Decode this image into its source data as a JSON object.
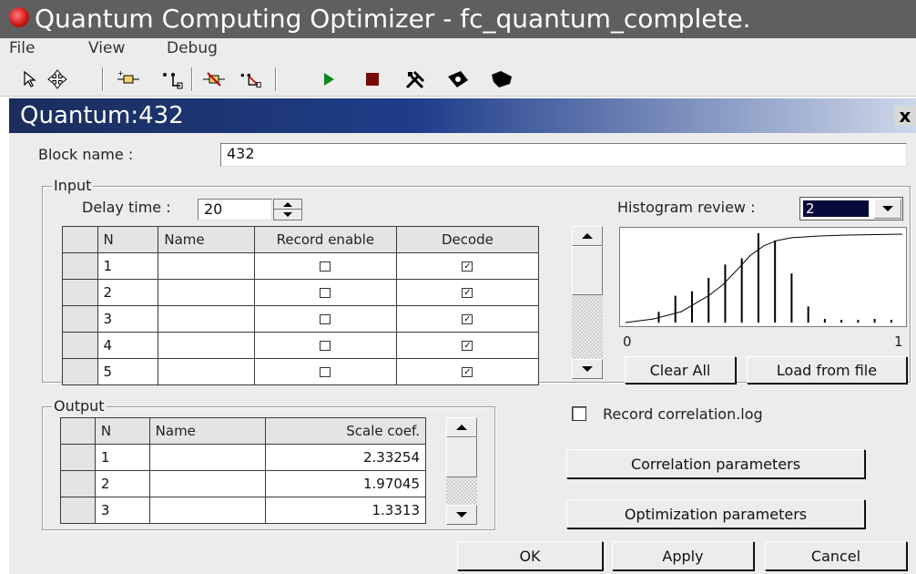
{
  "app": {
    "title": "Quantum Computing Optimizer - fc_quantum_complete.",
    "menu": [
      "File",
      "View",
      "Debug"
    ],
    "toolbar_icons": [
      "pointer-icon",
      "move-icon",
      "add-block-icon",
      "add-link-icon",
      "remove-block-icon",
      "remove-link-icon",
      "run-icon",
      "stop-icon",
      "tools-icon",
      "debug-icon",
      "flag-icon"
    ]
  },
  "dialog": {
    "title": "Quantum:432",
    "close_label": "x",
    "block_name_label": "Block name :",
    "block_name_value": "432",
    "input": {
      "group_label": "Input",
      "delay_label": "Delay time :",
      "delay_value": "20",
      "columns": [
        "N",
        "Name",
        "Record enable",
        "Decode"
      ],
      "rows": [
        {
          "n": "1",
          "name": "",
          "record": false,
          "decode": true
        },
        {
          "n": "2",
          "name": "",
          "record": false,
          "decode": true
        },
        {
          "n": "3",
          "name": "",
          "record": false,
          "decode": true
        },
        {
          "n": "4",
          "name": "",
          "record": false,
          "decode": true
        },
        {
          "n": "5",
          "name": "",
          "record": false,
          "decode": true
        }
      ]
    },
    "histogram": {
      "label": "Histogram review :",
      "selected": "2",
      "x_min_label": "0",
      "x_max_label": "1",
      "clear_label": "Clear All",
      "load_label": "Load from file"
    },
    "output": {
      "group_label": "Output",
      "columns": [
        "N",
        "Name",
        "Scale coef."
      ],
      "rows": [
        {
          "n": "1",
          "name": "",
          "scale": "2.33254"
        },
        {
          "n": "2",
          "name": "",
          "scale": "1.97045"
        },
        {
          "n": "3",
          "name": "",
          "scale": "1.3313"
        }
      ]
    },
    "record_correlation_label": "Record correlation.log",
    "record_correlation_checked": false,
    "correlation_button": "Correlation parameters",
    "optimization_button": "Optimization parameters",
    "ok_label": "OK",
    "apply_label": "Apply",
    "cancel_label": "Cancel"
  },
  "chart_data": {
    "type": "bar",
    "x": [
      0.12,
      0.18,
      0.24,
      0.3,
      0.36,
      0.42,
      0.48,
      0.54,
      0.6,
      0.66,
      0.72,
      0.78,
      0.84,
      0.9,
      0.96
    ],
    "values": [
      0.12,
      0.3,
      0.35,
      0.5,
      0.65,
      0.72,
      1.0,
      0.92,
      0.55,
      0.18,
      0.04,
      0.03,
      0.03,
      0.04,
      0.03
    ],
    "curve_x": [
      0.0,
      0.1,
      0.2,
      0.3,
      0.35,
      0.4,
      0.45,
      0.5,
      0.55,
      0.6,
      0.7,
      0.8,
      0.9,
      1.0
    ],
    "curve_y": [
      0.0,
      0.04,
      0.12,
      0.3,
      0.42,
      0.58,
      0.75,
      0.86,
      0.92,
      0.95,
      0.97,
      0.98,
      0.985,
      0.99
    ],
    "xlim": [
      0,
      1
    ],
    "ylim": [
      0,
      1
    ],
    "grid": false,
    "colors": {
      "bars": "#000000",
      "curve": "#000000"
    }
  }
}
